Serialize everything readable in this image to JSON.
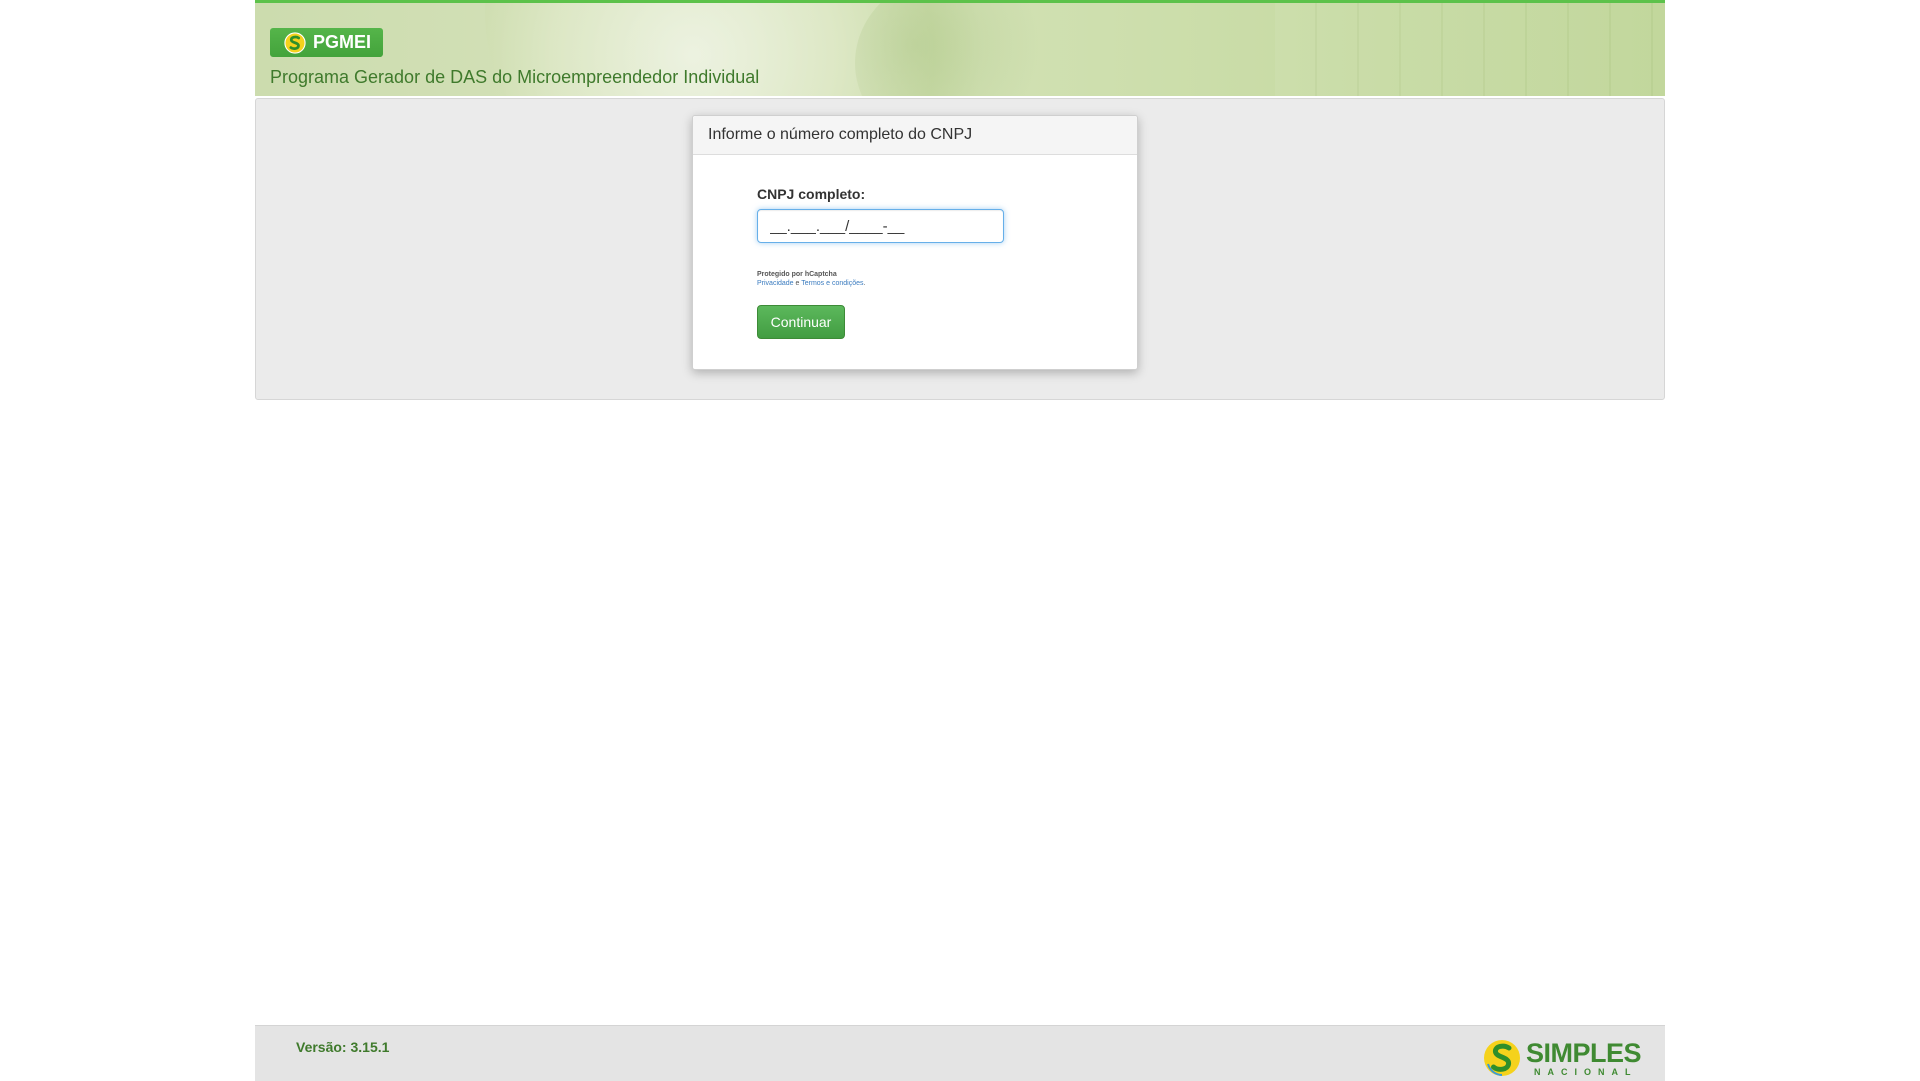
{
  "header": {
    "brand": "PGMEI",
    "subtitle": "Programa Gerador de DAS do Microempreendedor Individual",
    "border_color": "#5cc24a"
  },
  "dialog": {
    "title": "Informe o número completo do CNPJ",
    "field_label": "CNPJ completo:",
    "cnpj_value": "__.___.___/____-__",
    "captcha": {
      "protected_text": "Protegido por hCaptcha",
      "privacy_link": "Privacidade",
      "connector": " e ",
      "terms_link": "Termos e condições",
      "suffix": "."
    },
    "continue_label": "Continuar"
  },
  "footer": {
    "version": "Versão: 3.15.1",
    "logo_word1": "SIMPLES",
    "logo_word2": "NACIONAL"
  },
  "icons": {
    "brand_logo": "simples-s-icon",
    "footer_logo": "simples-nacional-logo"
  },
  "colors": {
    "accent_green": "#4caf50",
    "text_green": "#3f7a2c",
    "focus_blue": "#66afe9"
  }
}
